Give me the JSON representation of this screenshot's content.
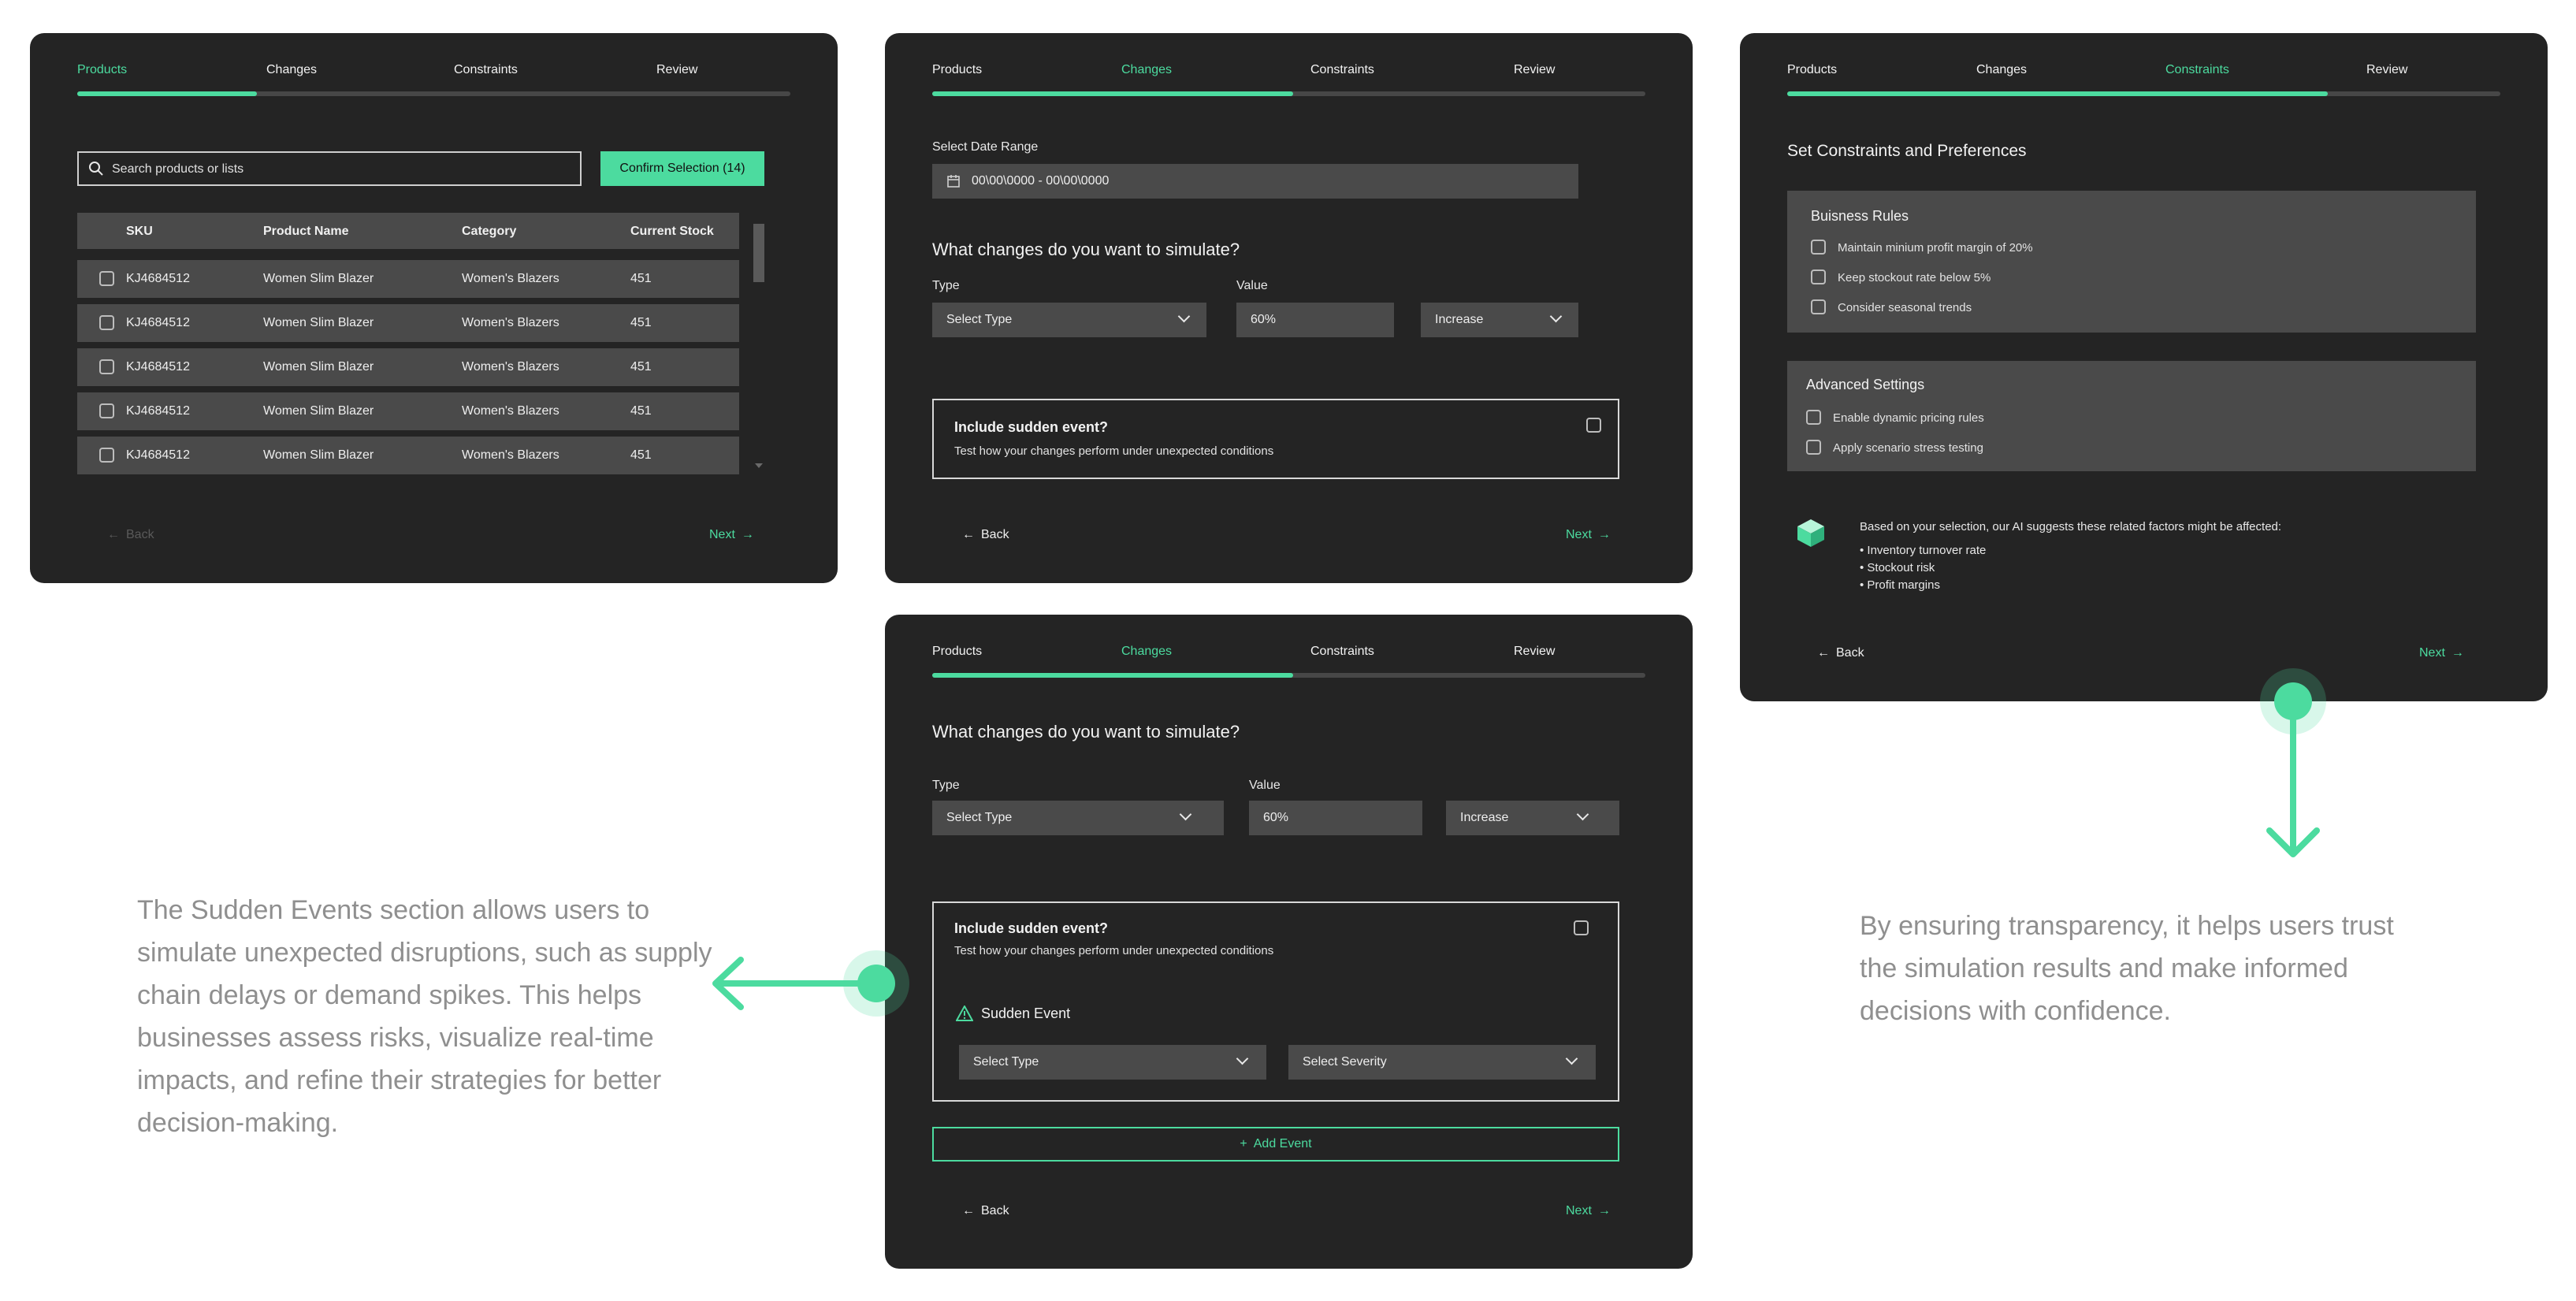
{
  "accent_color": "#4cdb9f",
  "panel_color": "#242424",
  "steps": [
    "Products",
    "Changes",
    "Constraints",
    "Review"
  ],
  "nav": {
    "back": "Back",
    "next": "Next",
    "back_icon": "arrow-left-icon",
    "next_icon": "arrow-right-icon"
  },
  "products": {
    "search_placeholder": "Search products or lists",
    "confirm_label": "Confirm Selection (14)",
    "columns": [
      "SKU",
      "Product Name",
      "Category",
      "Current Stock"
    ],
    "rows": [
      {
        "sku": "KJ4684512",
        "name": "Women Slim Blazer",
        "category": "Women's Blazers",
        "stock": "451"
      },
      {
        "sku": "KJ4684512",
        "name": "Women Slim Blazer",
        "category": "Women's Blazers",
        "stock": "451"
      },
      {
        "sku": "KJ4684512",
        "name": "Women Slim Blazer",
        "category": "Women's Blazers",
        "stock": "451"
      },
      {
        "sku": "KJ4684512",
        "name": "Women Slim Blazer",
        "category": "Women's Blazers",
        "stock": "451"
      },
      {
        "sku": "KJ4684512",
        "name": "Women Slim Blazer",
        "category": "Women's Blazers",
        "stock": "451"
      }
    ]
  },
  "changes": {
    "date_range_label": "Select Date Range",
    "date_range_value": "00\\00\\0000 - 00\\00\\0000",
    "question": "What changes do you want to simulate?",
    "type_label": "Type",
    "type_value": "Select Type",
    "value_label": "Value",
    "value_value": "60%",
    "direction_value": "Increase",
    "sudden_title": "Include sudden event?",
    "sudden_desc": "Test how your changes perform under unexpected conditions"
  },
  "sudden_event": {
    "heading": "Sudden Event",
    "type_value": "Select Type",
    "severity_value": "Select Severity",
    "add_label": "Add Event"
  },
  "constraints": {
    "title": "Set Constraints and Preferences",
    "business_rules_title": "Buisness Rules",
    "business_rules": [
      "Maintain minium profit margin of 20%",
      "Keep stockout rate below 5%",
      "Consider seasonal trends"
    ],
    "advanced_title": "Advanced Settings",
    "advanced": [
      "Enable dynamic pricing rules",
      "Apply scenario stress testing"
    ],
    "ai_text": "Based on your selection, our AI suggests these related factors might be affected:",
    "ai_factors": [
      "Inventory turnover rate",
      "Stockout risk",
      "Profit margins"
    ]
  },
  "notes": {
    "left": [
      "The Sudden Events section allows users to",
      "simulate unexpected disruptions, such as supply",
      "chain delays or demand spikes. This helps",
      "businesses assess risks, visualize real-time",
      "impacts, and refine their strategies for better",
      "decision-making."
    ],
    "right": [
      "By ensuring transparency, it helps users trust",
      "the simulation results and make informed",
      "decisions with confidence."
    ]
  }
}
